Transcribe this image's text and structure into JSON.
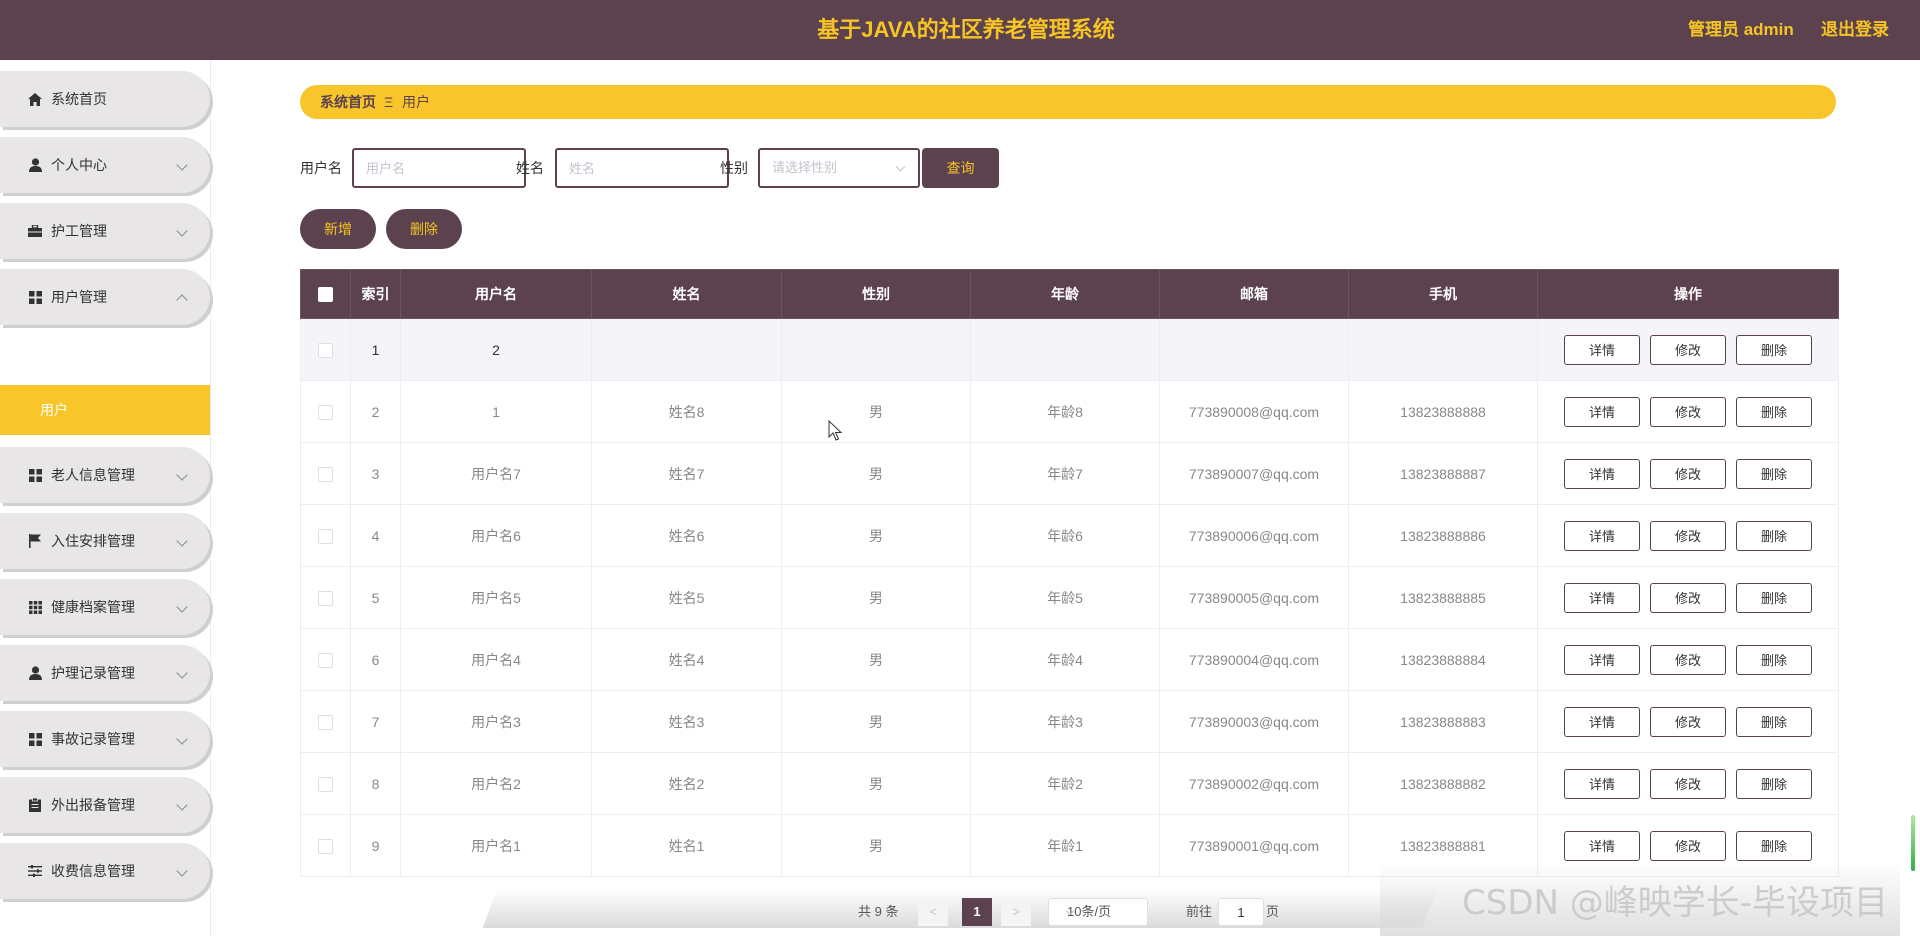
{
  "header": {
    "title": "基于JAVA的社区养老管理系统",
    "admin_label": "管理员 admin",
    "logout_label": "退出登录"
  },
  "sidebar": {
    "items": [
      {
        "label": "系统首页",
        "icon": "home-icon"
      },
      {
        "label": "个人中心",
        "icon": "user-icon"
      },
      {
        "label": "护工管理",
        "icon": "briefcase-icon"
      },
      {
        "label": "用户管理",
        "icon": "grid-icon"
      },
      {
        "label": "老人信息管理",
        "icon": "grid-icon"
      },
      {
        "label": "入住安排管理",
        "icon": "flag-icon"
      },
      {
        "label": "健康档案管理",
        "icon": "apps-icon"
      },
      {
        "label": "护理记录管理",
        "icon": "user-icon"
      },
      {
        "label": "事故记录管理",
        "icon": "grid-icon"
      },
      {
        "label": "外出报备管理",
        "icon": "clipboard-icon"
      },
      {
        "label": "收费信息管理",
        "icon": "sliders-icon"
      }
    ],
    "active_sub": "用户"
  },
  "breadcrumb": {
    "home": "系统首页",
    "separator": "Ξ",
    "current": "用户"
  },
  "search": {
    "username_label": "用户名",
    "username_placeholder": "用户名",
    "name_label": "姓名",
    "name_placeholder": "姓名",
    "gender_label": "性别",
    "gender_placeholder": "请选择性别",
    "query_button": "查询"
  },
  "actions": {
    "add_button": "新增",
    "delete_button": "删除"
  },
  "table": {
    "columns": [
      "索引",
      "用户名",
      "姓名",
      "性别",
      "年龄",
      "邮箱",
      "手机",
      "操作"
    ],
    "rows": [
      {
        "index": "1",
        "username": "2",
        "name": "",
        "gender": "",
        "age": "",
        "email": "",
        "phone": ""
      },
      {
        "index": "2",
        "username": "1",
        "name": "姓名8",
        "gender": "男",
        "age": "年龄8",
        "email": "773890008@qq.com",
        "phone": "13823888888"
      },
      {
        "index": "3",
        "username": "用户名7",
        "name": "姓名7",
        "gender": "男",
        "age": "年龄7",
        "email": "773890007@qq.com",
        "phone": "13823888887"
      },
      {
        "index": "4",
        "username": "用户名6",
        "name": "姓名6",
        "gender": "男",
        "age": "年龄6",
        "email": "773890006@qq.com",
        "phone": "13823888886"
      },
      {
        "index": "5",
        "username": "用户名5",
        "name": "姓名5",
        "gender": "男",
        "age": "年龄5",
        "email": "773890005@qq.com",
        "phone": "13823888885"
      },
      {
        "index": "6",
        "username": "用户名4",
        "name": "姓名4",
        "gender": "男",
        "age": "年龄4",
        "email": "773890004@qq.com",
        "phone": "13823888884"
      },
      {
        "index": "7",
        "username": "用户名3",
        "name": "姓名3",
        "gender": "男",
        "age": "年龄3",
        "email": "773890003@qq.com",
        "phone": "13823888883"
      },
      {
        "index": "8",
        "username": "用户名2",
        "name": "姓名2",
        "gender": "男",
        "age": "年龄2",
        "email": "773890002@qq.com",
        "phone": "13823888882"
      },
      {
        "index": "9",
        "username": "用户名1",
        "name": "姓名1",
        "gender": "男",
        "age": "年龄1",
        "email": "773890001@qq.com",
        "phone": "13823888881"
      }
    ],
    "row_buttons": {
      "detail": "详情",
      "edit": "修改",
      "delete": "删除"
    }
  },
  "pagination": {
    "total": "共 9 条",
    "prev": "<",
    "next": ">",
    "current_page": "1",
    "page_size": "10条/页",
    "goto_label": "前往",
    "goto_value": "1",
    "goto_unit": "页"
  },
  "watermark": "CSDN @峰映学长-毕设项目",
  "colors": {
    "primary": "#5c414f",
    "accent": "#f8c62a",
    "header_text": "#f6c523"
  }
}
